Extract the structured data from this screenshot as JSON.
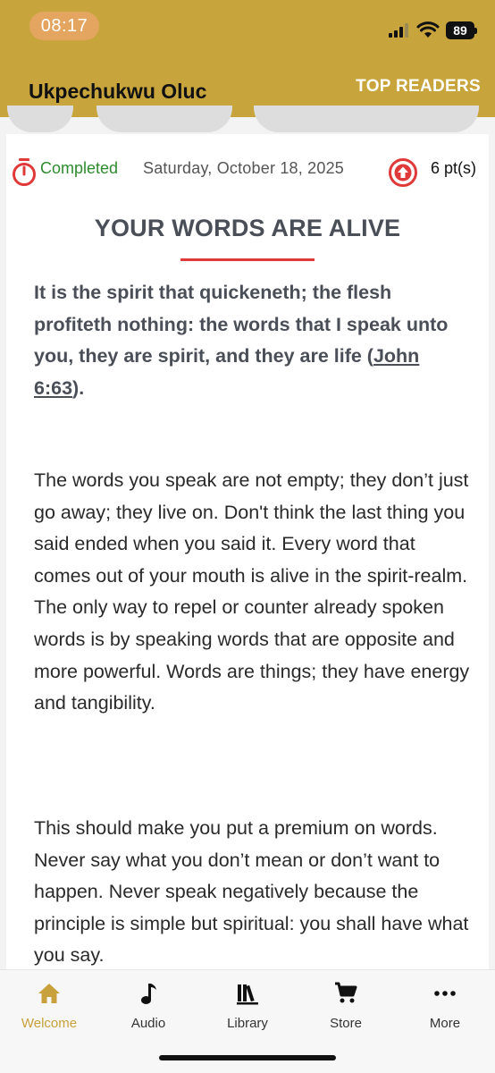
{
  "status_bar": {
    "time": "08:17",
    "battery": "89"
  },
  "header": {
    "user_name": "Ukpechukwu Oluc",
    "top_readers_label": "TOP READERS"
  },
  "meta": {
    "status_label": "Completed",
    "date": "Saturday, October 18, 2025",
    "points": "6 pt(s)",
    "colors": {
      "completed": "#2e8b2e",
      "accent_red": "#e0393a"
    }
  },
  "article": {
    "title": "YOUR WORDS ARE ALIVE",
    "scripture_text": "It is the spirit that quickeneth; the flesh profiteth nothing: the words that I speak unto you, they are spirit, and they are life (",
    "scripture_ref": "John 6:63",
    "scripture_end": ").",
    "paragraphs": [
      "The words you speak are not empty; they don’t just go away; they live on. Don't think the last thing you said ended when you said it. Every word that comes out of your mouth is alive in the spirit-realm. The only way to repel or counter already spoken words is by speaking words that are opposite and more powerful. Words are things; they have energy and tangibility.",
      "This should make you put a premium on words. Never say what you don’t mean or don’t want to happen. Never speak negatively because the principle is simple but spiritual: you shall have what you say."
    ]
  },
  "tabs": [
    {
      "label": "Welcome",
      "icon": "home-icon",
      "active": true
    },
    {
      "label": "Audio",
      "icon": "music-note-icon",
      "active": false
    },
    {
      "label": "Library",
      "icon": "library-icon",
      "active": false
    },
    {
      "label": "Store",
      "icon": "cart-icon",
      "active": false
    },
    {
      "label": "More",
      "icon": "more-icon",
      "active": false
    }
  ],
  "colors": {
    "header": "#c7a53c",
    "accent": "#c8a13c"
  }
}
